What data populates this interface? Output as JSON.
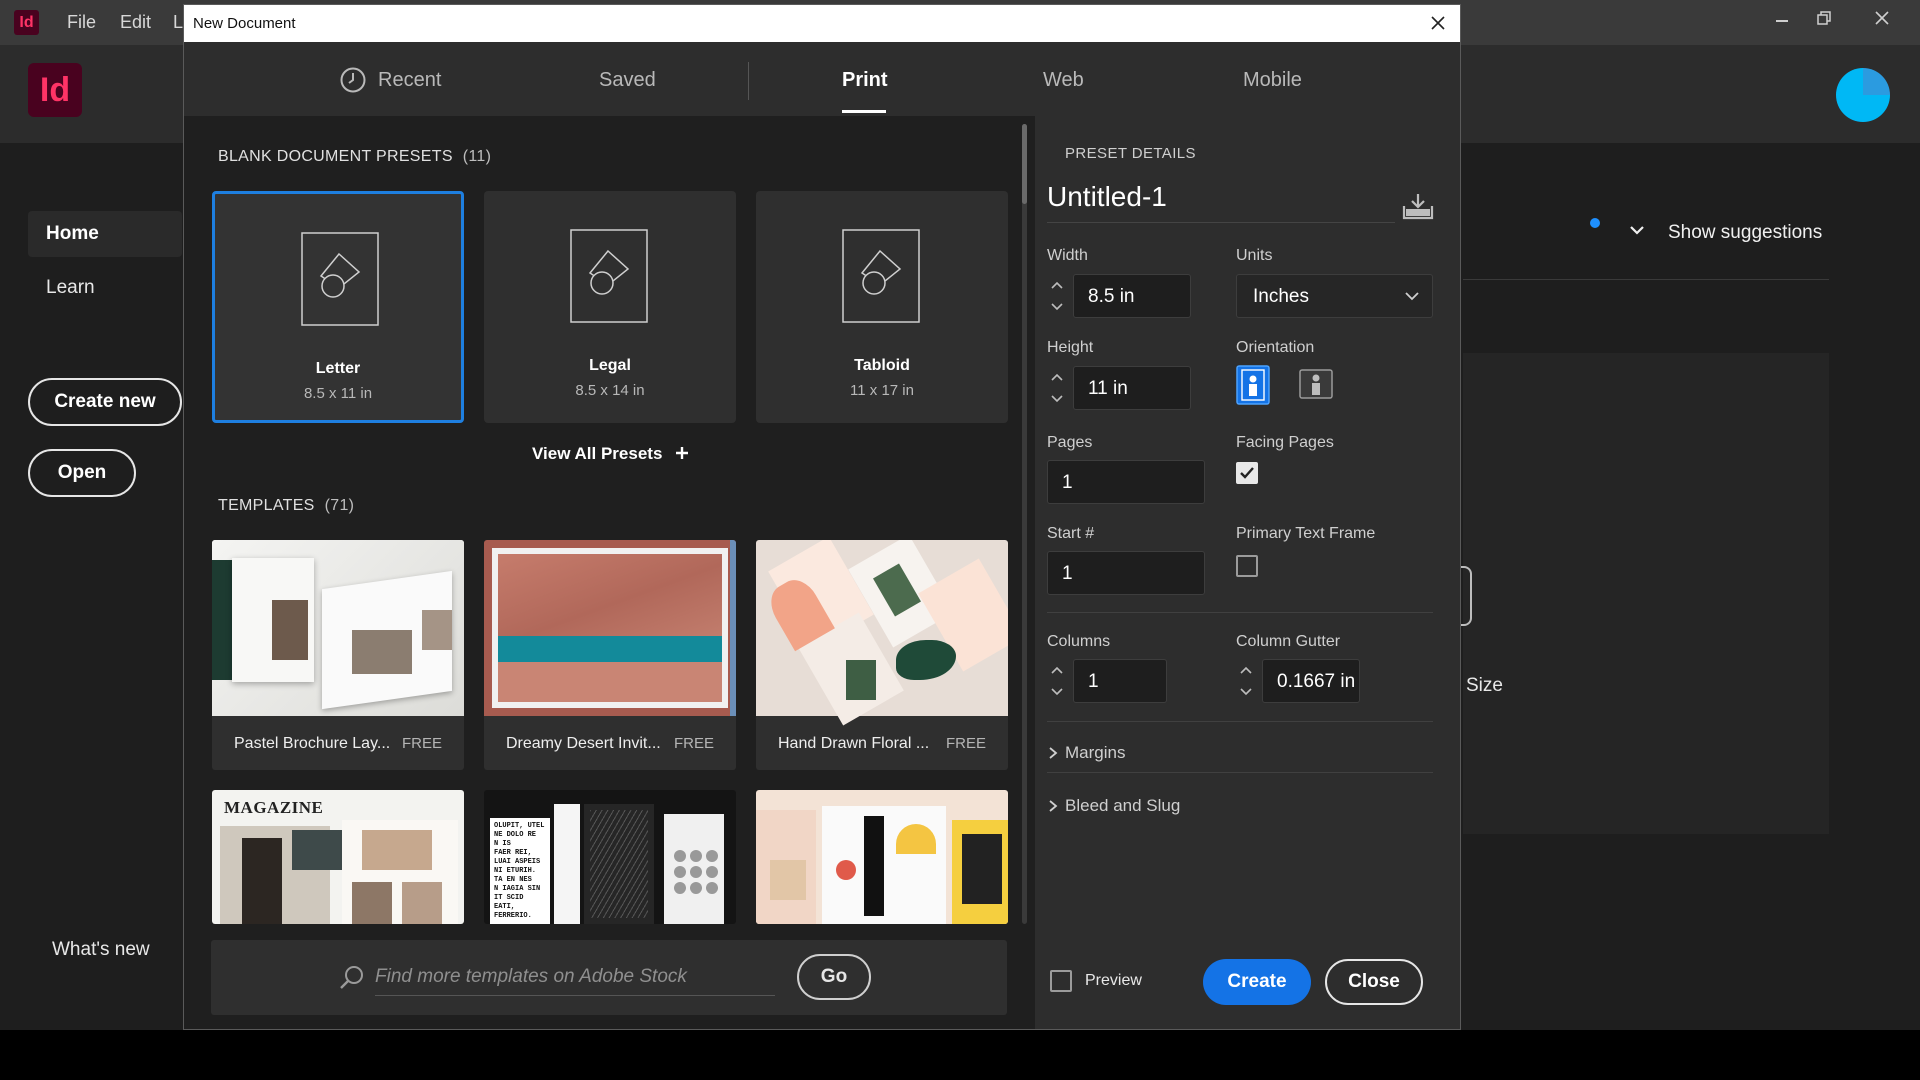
{
  "app": {
    "logo": "Id",
    "menu": [
      "File",
      "Edit",
      "L"
    ],
    "sidebar": {
      "home": "Home",
      "learn": "Learn",
      "create_new": "Create new",
      "open": "Open",
      "whats_new": "What's new"
    },
    "show_suggestions": "Show suggestions",
    "right_size_label": "Size"
  },
  "dialog": {
    "title": "New Document",
    "tabs": [
      "Recent",
      "Saved",
      "Print",
      "Web",
      "Mobile"
    ],
    "active_tab": "Print",
    "blank_presets": {
      "heading": "BLANK DOCUMENT PRESETS",
      "count": "(11)",
      "items": [
        {
          "name": "Letter",
          "size": "8.5 x 11 in",
          "selected": true
        },
        {
          "name": "Legal",
          "size": "8.5 x 14 in",
          "selected": false
        },
        {
          "name": "Tabloid",
          "size": "11 x 17 in",
          "selected": false
        }
      ],
      "view_all": "View All Presets"
    },
    "templates": {
      "heading": "TEMPLATES",
      "count": "(71)",
      "items": [
        {
          "name": "Pastel Brochure Lay...",
          "badge": "FREE"
        },
        {
          "name": "Dreamy Desert Invit...",
          "badge": "FREE"
        },
        {
          "name": "Hand Drawn Floral ...",
          "badge": "FREE"
        }
      ]
    },
    "search": {
      "placeholder": "Find more templates on Adobe Stock",
      "go": "Go"
    },
    "preset_details": {
      "heading": "PRESET DETAILS",
      "name": "Untitled-1",
      "width_label": "Width",
      "width_value": "8.5 in",
      "units_label": "Units",
      "units_value": "Inches",
      "height_label": "Height",
      "height_value": "11 in",
      "orientation_label": "Orientation",
      "orientation_selected": "portrait",
      "pages_label": "Pages",
      "pages_value": "1",
      "facing_pages_label": "Facing Pages",
      "facing_pages_checked": true,
      "start_label": "Start #",
      "start_value": "1",
      "primary_text_frame_label": "Primary Text Frame",
      "primary_text_frame_checked": false,
      "columns_label": "Columns",
      "columns_value": "1",
      "column_gutter_label": "Column Gutter",
      "column_gutter_value": "0.1667 in",
      "margins_label": "Margins",
      "bleed_label": "Bleed and Slug",
      "preview_label": "Preview",
      "create_label": "Create",
      "close_label": "Close"
    },
    "colors": {
      "accent": "#1473e6",
      "selected_border": "#1e7fe0",
      "logo_bg": "#49021f",
      "logo_fg": "#ff3366"
    }
  }
}
